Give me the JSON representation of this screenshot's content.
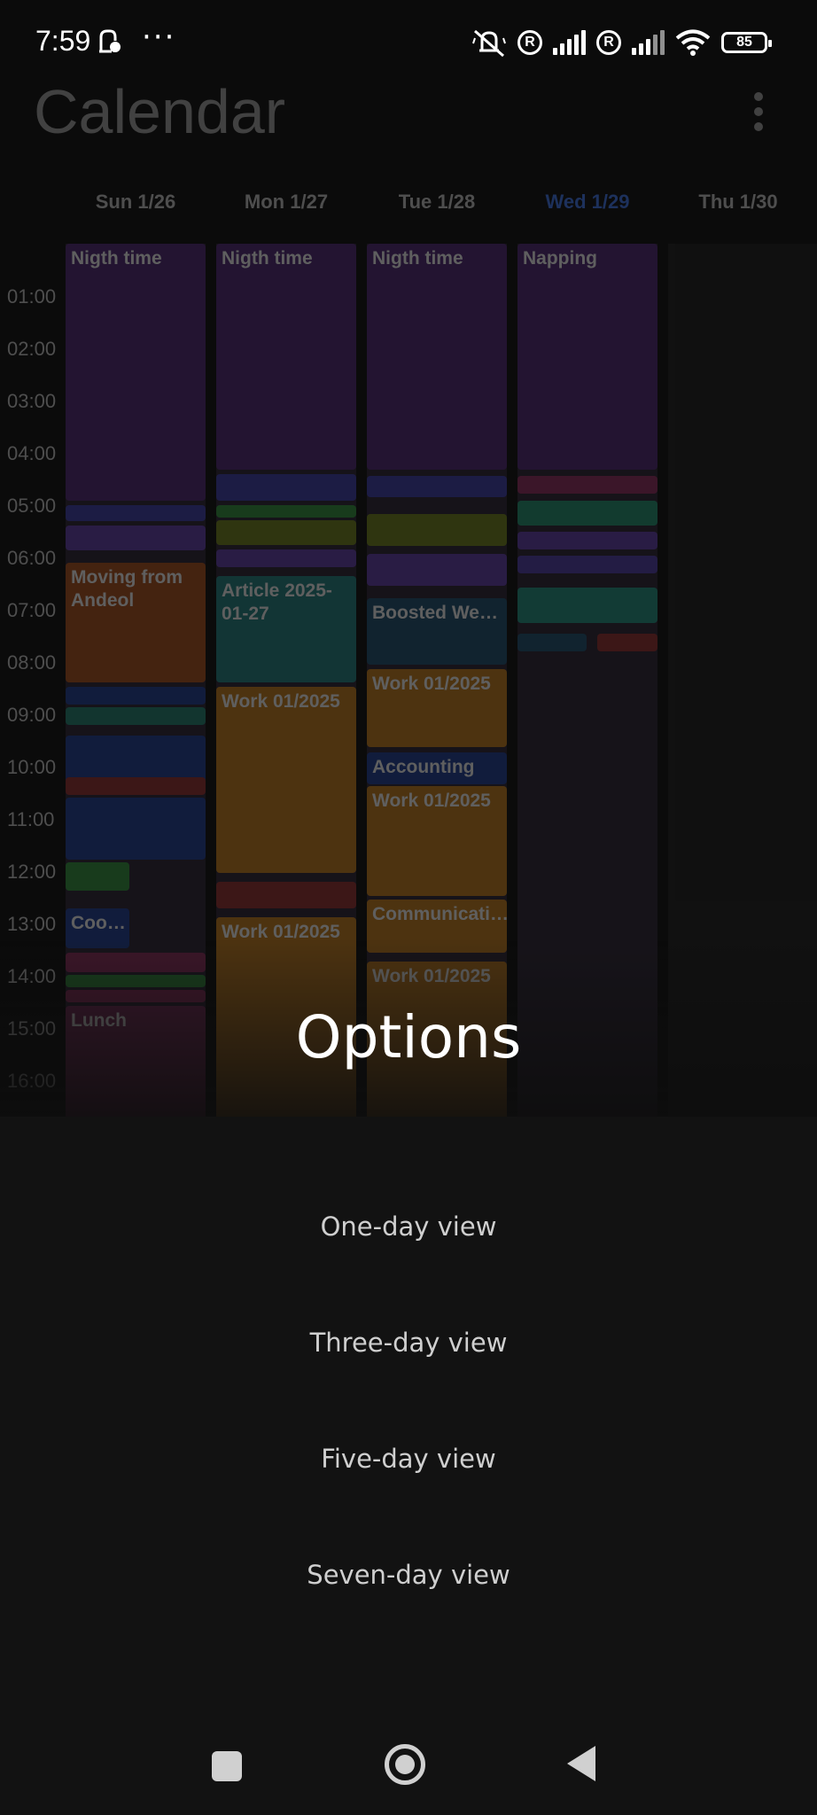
{
  "status_bar": {
    "time": "7:59",
    "more": "···",
    "battery": "85",
    "roaming_badge": "R",
    "icons": [
      "notification-icon",
      "mute-vibrate-icon",
      "roaming-icon",
      "signal-icon",
      "wifi-icon",
      "battery-icon"
    ]
  },
  "calendar": {
    "title": "Calendar",
    "days": [
      {
        "label": "Sun 1/26",
        "today": false
      },
      {
        "label": "Mon 1/27",
        "today": false
      },
      {
        "label": "Tue 1/28",
        "today": false
      },
      {
        "label": "Wed 1/29",
        "today": true
      },
      {
        "label": "Thu 1/30",
        "today": false
      }
    ],
    "hours": [
      "01:00",
      "02:00",
      "03:00",
      "04:00",
      "05:00",
      "06:00",
      "07:00",
      "08:00",
      "09:00",
      "10:00",
      "11:00",
      "12:00",
      "13:00",
      "14:00",
      "15:00",
      "16:00"
    ],
    "events": {
      "sun": [
        "Nigth time",
        "Moving from Andeol",
        "Coo…",
        "Lunch"
      ],
      "mon": [
        "Nigth time",
        "Article 2025-01-27",
        "Work 01/2025",
        "Work 01/2025"
      ],
      "tue": [
        "Nigth time",
        "Boosted We…",
        "Work 01/2025",
        "Accounting",
        "Work 01/2025",
        "Communicati…",
        "Work 01/2025"
      ],
      "wed": [
        "Napping"
      ]
    },
    "colors": {
      "night": "#5a2a7a",
      "orange": "#b8741a",
      "teal": "#1f7a6a",
      "blue": "#1c3a8c",
      "red": "#8c2b2b",
      "green": "#2e7a3a",
      "pink": "#8a2a5a",
      "today": "#3b6fe0"
    }
  },
  "options": {
    "title": "Options",
    "items": [
      "One-day view",
      "Three-day view",
      "Five-day view",
      "Seven-day view"
    ]
  },
  "nav": {
    "icons": [
      "recents-square-icon",
      "home-circle-icon",
      "back-triangle-icon"
    ]
  }
}
